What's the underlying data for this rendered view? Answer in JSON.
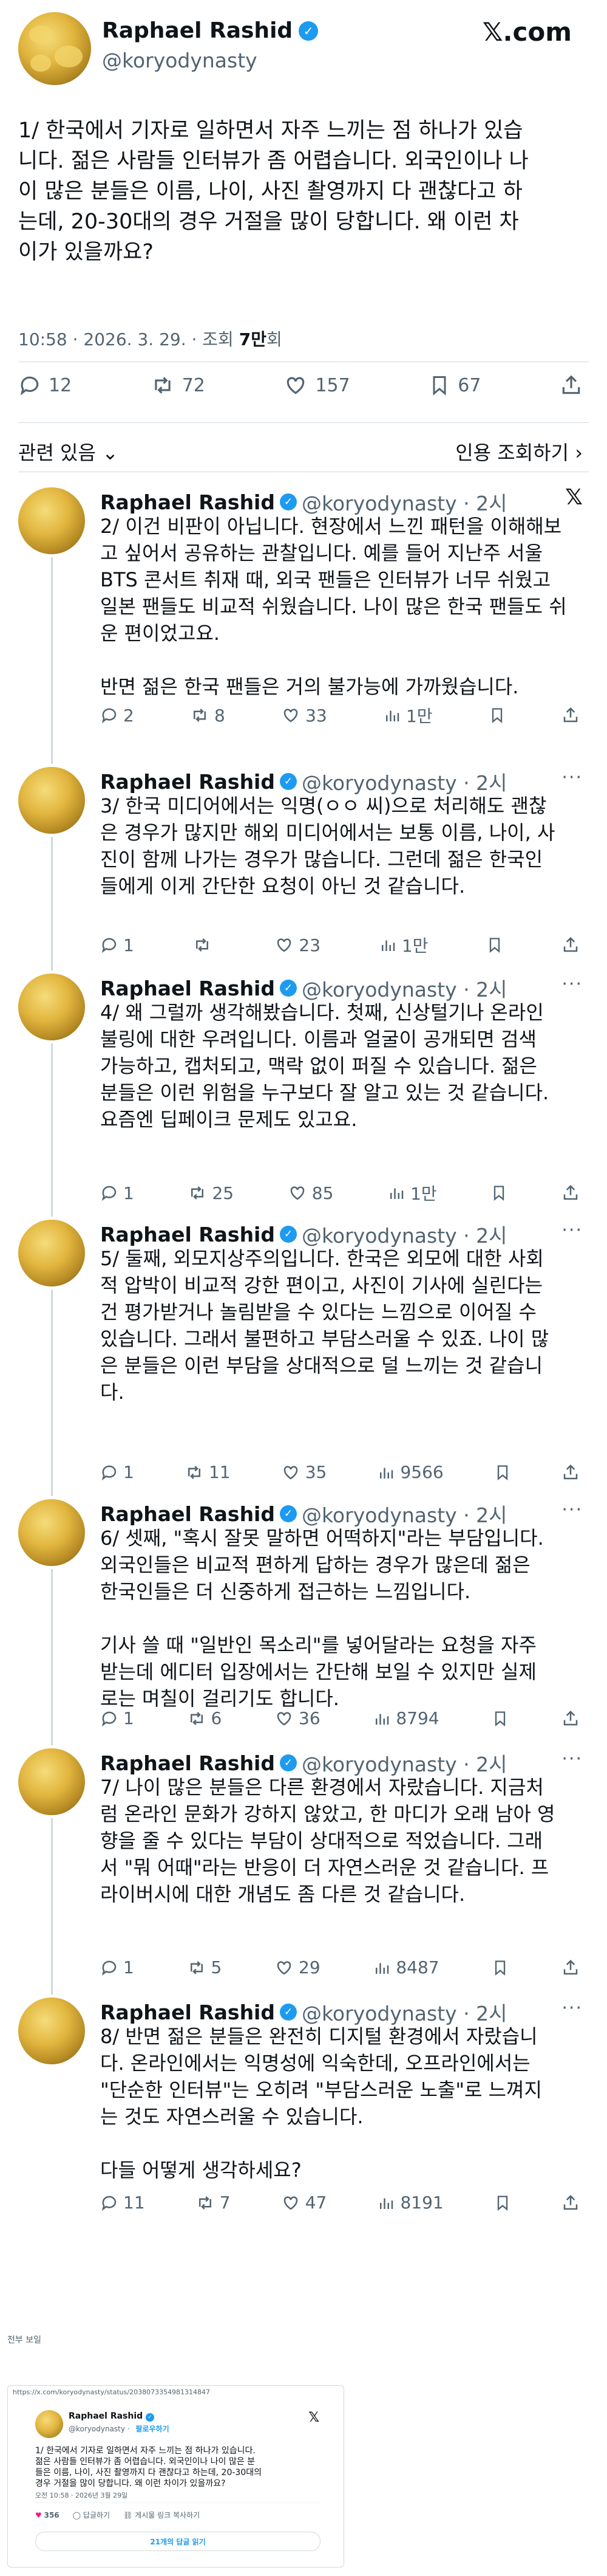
{
  "main": {
    "name": "Raphael Rashid",
    "handle": "@koryodynasty",
    "brand": "𝕏.com",
    "text": "1/ 한국에서 기자로 일하면서 자주 느끼는 점 하나가 있습\n니다. 젊은 사람들 인터뷰가 좀 어렵습니다. 외국인이나 나\n이 많은 분들은 이름, 나이, 사진 촬영까지 다 괜찮다고 하\n는데, 20-30대의 경우 거절을 많이 당합니다. 왜 이런 차\n이가 있을까요?",
    "time": "10:58 · 2026. 3. 29. · 조회 ",
    "views": "7만",
    "views_suffix": "회",
    "replies": "12",
    "retweets": "72",
    "likes": "157",
    "bookmarks": "67",
    "related_label": "관련 있음",
    "quote_label": "인용 조회하기"
  },
  "replies": [
    {
      "name": "Raphael Rashid",
      "handle": "@koryodynasty · 2시",
      "text": "2/ 이건 비판이 아닙니다. 현장에서 느낀 패턴을 이해해보\n고 싶어서 공유하는 관찰입니다. 예를 들어 지난주 서울\nBTS 콘서트 취재 때, 외국 팬들은 인터뷰가 너무 쉬웠고\n일본 팬들도 비교적 쉬웠습니다. 나이 많은 한국 팬들도 쉬\n운 편이었고요.\n\n반면 젊은 한국 팬들은 거의 불가능에 가까웠습니다.",
      "replies": "2",
      "retweets": "8",
      "likes": "33",
      "views": "1만"
    },
    {
      "name": "Raphael Rashid",
      "handle": "@koryodynasty · 2시",
      "text": "3/ 한국 미디어에서는 익명(ㅇㅇ 씨)으로 처리해도 괜찮\n은 경우가 많지만 해외 미디어에서는 보통 이름, 나이, 사\n진이 함께 나가는 경우가 많습니다. 그런데 젊은 한국인\n들에게 이게 간단한 요청이 아닌 것 같습니다.",
      "replies": "1",
      "retweets": "",
      "likes": "23",
      "views": "1만"
    },
    {
      "name": "Raphael Rashid",
      "handle": "@koryodynasty · 2시",
      "text": "4/ 왜 그럴까 생각해봤습니다. 첫째, 신상털기나 온라인\n불링에 대한 우려입니다. 이름과 얼굴이 공개되면 검색\n가능하고, 캡처되고, 맥락 없이 퍼질 수 있습니다. 젊은\n분들은 이런 위험을 누구보다 잘 알고 있는 것 같습니다.\n요즘엔 딥페이크 문제도 있고요.",
      "replies": "1",
      "retweets": "25",
      "likes": "85",
      "views": "1만"
    },
    {
      "name": "Raphael Rashid",
      "handle": "@koryodynasty · 2시",
      "text": "5/ 둘째, 외모지상주의입니다. 한국은 외모에 대한 사회\n적 압박이 비교적 강한 편이고, 사진이 기사에 실린다는\n건 평가받거나 놀림받을 수 있다는 느낌으로 이어질 수\n있습니다. 그래서 불편하고 부담스러울 수 있죠. 나이 많\n은 분들은 이런 부담을 상대적으로 덜 느끼는 것 같습니\n다.",
      "replies": "1",
      "retweets": "11",
      "likes": "35",
      "views": "9566"
    },
    {
      "name": "Raphael Rashid",
      "handle": "@koryodynasty · 2시",
      "text": "6/ 셋째, \"혹시 잘못 말하면 어떡하지\"라는 부담입니다.\n외국인들은 비교적 편하게 답하는 경우가 많은데 젊은\n한국인들은 더 신중하게 접근하는 느낌입니다.\n\n기사 쓸 때 \"일반인 목소리\"를 넣어달라는 요청을 자주\n받는데 에디터 입장에서는 간단해 보일 수 있지만 실제\n로는 며칠이 걸리기도 합니다.",
      "replies": "1",
      "retweets": "6",
      "likes": "36",
      "views": "8794"
    },
    {
      "name": "Raphael Rashid",
      "handle": "@koryodynasty · 2시",
      "text": "7/ 나이 많은 분들은 다른 환경에서 자랐습니다. 지금처\n럼 온라인 문화가 강하지 않았고, 한 마디가 오래 남아 영\n향을 줄 수 있다는 부담이 상대적으로 적었습니다. 그래\n서 \"뭐 어때\"라는 반응이 더 자연스러운 것 같습니다. 프\n라이버시에 대한 개념도 좀 다른 것 같습니다.",
      "replies": "1",
      "retweets": "5",
      "likes": "29",
      "views": "8487"
    },
    {
      "name": "Raphael Rashid",
      "handle": "@koryodynasty · 2시",
      "text": "8/ 반면 젊은 분들은 완전히 디지털 환경에서 자랐습니\n다. 온라인에서는 익명성에 익숙한데, 오프라인에서는\n\"단순한 인터뷰\"는 오히려 \"부담스러운 노출\"로 느껴지\n는 것도 자연스러울 수 있습니다.\n\n다들 어떻게 생각하세요?",
      "replies": "11",
      "retweets": "7",
      "likes": "47",
      "views": "8191"
    }
  ],
  "footnote": "전부 보일",
  "embed": {
    "url": "https://x.com/koryodynasty/status/2038073354981314847",
    "name": "Raphael Rashid",
    "handle": "@koryodynasty",
    "follow": "팔로우하기",
    "text": "1/ 한국에서 기자로 일하면서 자주 느끼는 점 하나가 있습니다.\n젊은 사람들 인터뷰가 좀 어렵습니다. 외국인이나 나이 많은 분\n들은 이름, 나이, 사진 촬영까지 다 괜찮다고 하는데, 20-30대의\n경우 거절을 많이 당합니다. 왜 이런 차이가 있을까요?",
    "meta": "오전 10:58 · 2026년 3월 29일",
    "likes": "356",
    "reply_label": "답글하기",
    "copy_label": "게시물 링크 복사하기",
    "button": "21개의 답글 읽기"
  }
}
